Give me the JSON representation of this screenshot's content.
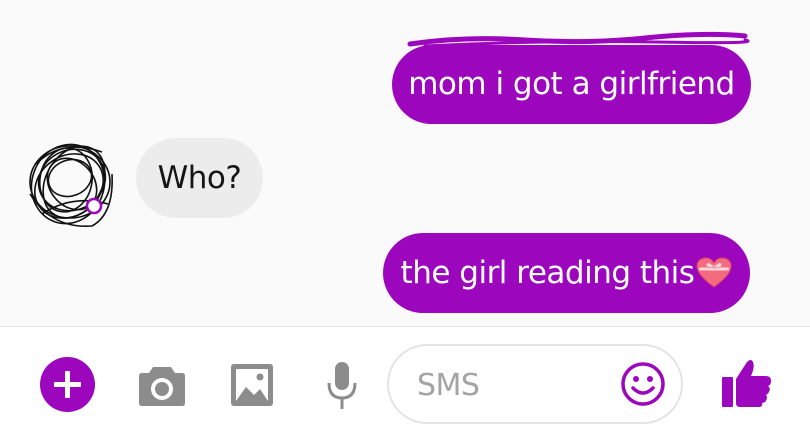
{
  "colors": {
    "accent": "#9c06bd",
    "incoming_bubble": "#ececec",
    "icon_gray": "#8c8c8c",
    "background": "#fafafa"
  },
  "messages": [
    {
      "direction": "outgoing",
      "text": "mom i got a girlfriend"
    },
    {
      "direction": "incoming",
      "text": "Who?"
    },
    {
      "direction": "outgoing",
      "text": "the girl reading this",
      "emoji": "heart-with-ribbon"
    }
  ],
  "composer": {
    "input_placeholder": "SMS",
    "icons": [
      "plus-icon",
      "camera-icon",
      "image-icon",
      "microphone-icon",
      "smiley-icon",
      "thumbs-up-icon"
    ]
  }
}
